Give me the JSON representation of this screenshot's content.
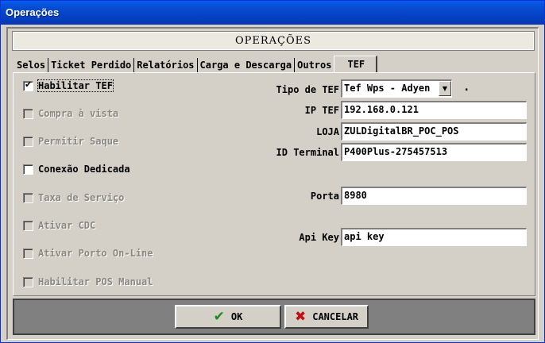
{
  "window": {
    "title": "Operações"
  },
  "header": {
    "title": "OPERAÇÕES"
  },
  "tabs": [
    {
      "label": "Selos",
      "active": false
    },
    {
      "label": "Ticket Perdido",
      "active": false
    },
    {
      "label": "Relatórios",
      "active": false
    },
    {
      "label": "Carga e Descarga",
      "active": false
    },
    {
      "label": "Outros",
      "active": false
    },
    {
      "label": "TEF",
      "active": true
    }
  ],
  "checkboxes": [
    {
      "label": "Habilitar TEF",
      "checked": true,
      "enabled": true
    },
    {
      "label": "Compra à vista",
      "checked": false,
      "enabled": false
    },
    {
      "label": "Permitir Saque",
      "checked": false,
      "enabled": false
    },
    {
      "label": "Conexão Dedicada",
      "checked": false,
      "enabled": true
    },
    {
      "label": "Taxa de Serviço",
      "checked": false,
      "enabled": false
    },
    {
      "label": "Ativar CDC",
      "checked": false,
      "enabled": false
    },
    {
      "label": "Ativar Porto On-Line",
      "checked": false,
      "enabled": false
    },
    {
      "label": "Habilitar POS Manual",
      "checked": false,
      "enabled": false
    }
  ],
  "fields": {
    "tipo_tef": {
      "label": "Tipo de TEF",
      "value": "Tef Wps - Adyen",
      "suffix": "."
    },
    "ip_tef": {
      "label": "IP TEF",
      "value": "192.168.0.121"
    },
    "loja": {
      "label": "LOJA",
      "value": "ZULDigitalBR_POC_POS"
    },
    "id_terminal": {
      "label": "ID Terminal",
      "value": "P400Plus-275457513"
    },
    "porta": {
      "label": "Porta",
      "value": "8980"
    },
    "api_key": {
      "label": "Api Key",
      "value": "api key"
    }
  },
  "buttons": {
    "ok": {
      "label": "OK",
      "icon": "check-icon",
      "color": "#1a8c1a"
    },
    "cancel": {
      "label": "CANCELAR",
      "icon": "x-icon",
      "color": "#c01010"
    }
  }
}
